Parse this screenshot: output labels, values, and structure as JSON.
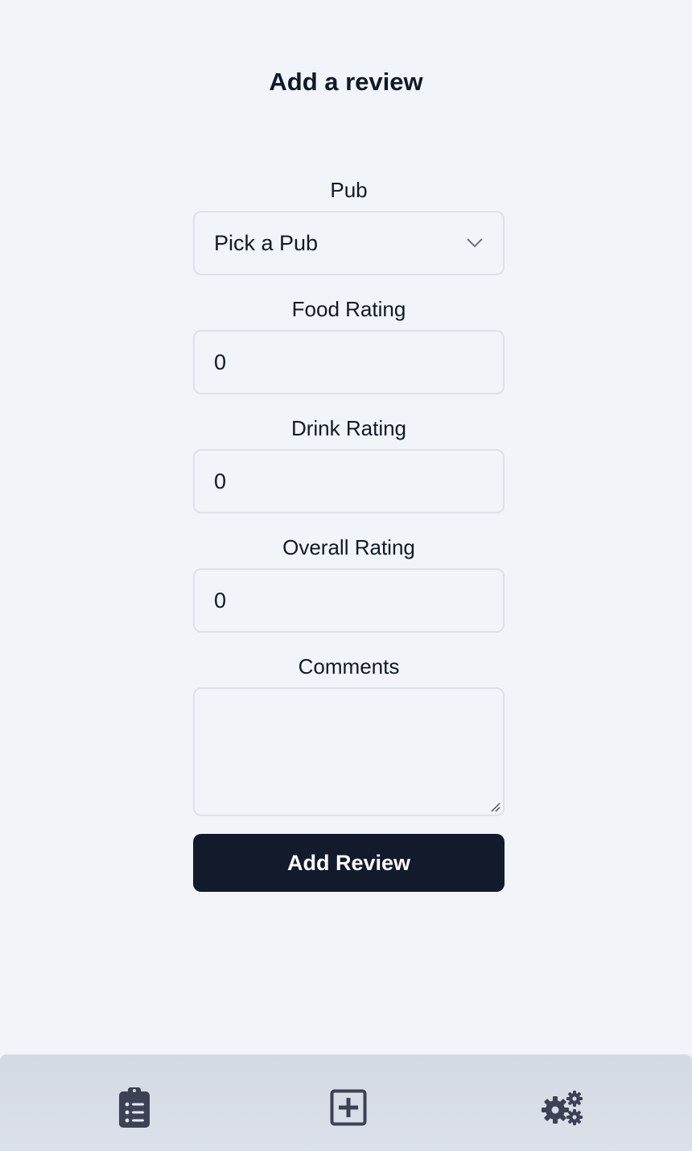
{
  "page": {
    "title": "Add a review"
  },
  "form": {
    "pub": {
      "label": "Pub",
      "selected": "Pick a Pub"
    },
    "food_rating": {
      "label": "Food Rating",
      "value": "0"
    },
    "drink_rating": {
      "label": "Drink Rating",
      "value": "0"
    },
    "overall_rating": {
      "label": "Overall Rating",
      "value": "0"
    },
    "comments": {
      "label": "Comments",
      "value": ""
    },
    "submit_label": "Add Review"
  },
  "nav": {
    "items": [
      {
        "icon": "clipboard-list-icon"
      },
      {
        "icon": "plus-square-icon"
      },
      {
        "icon": "gears-icon"
      }
    ]
  },
  "colors": {
    "background": "#f1f4f9",
    "primary_button": "#131a2c",
    "nav_background": "#d4dae4",
    "icon": "#3c4254"
  }
}
